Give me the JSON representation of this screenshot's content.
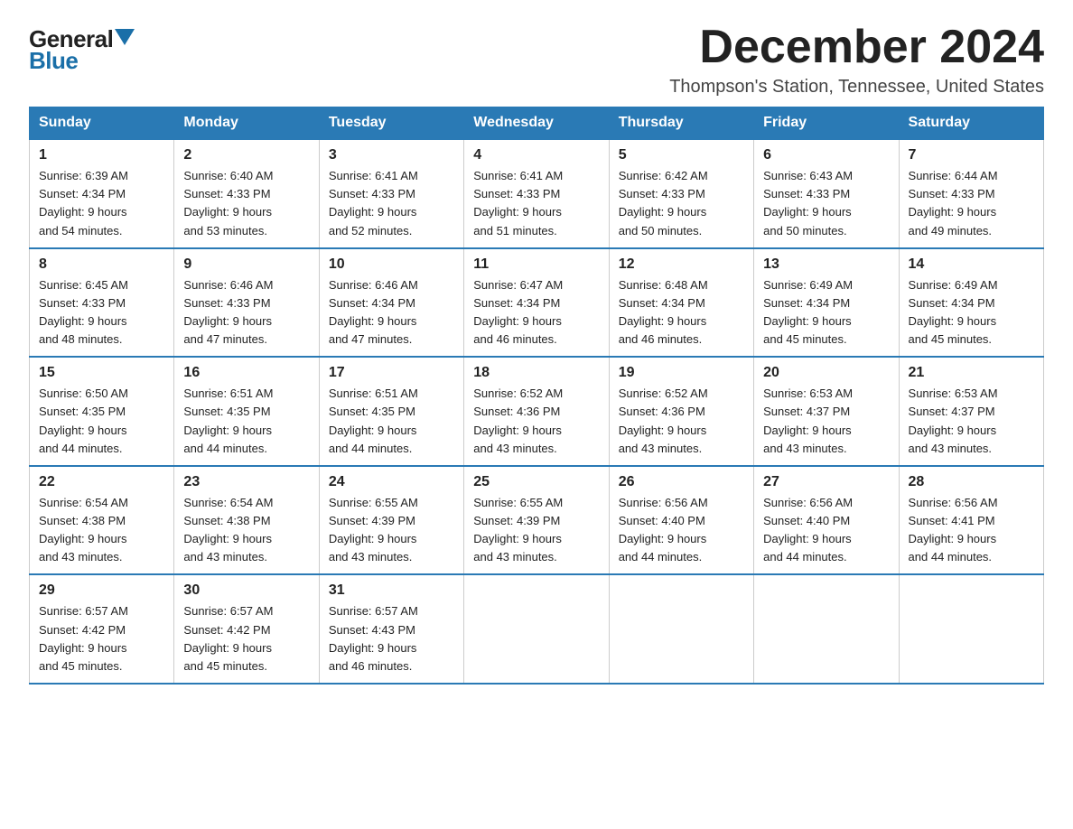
{
  "header": {
    "logo_general": "General",
    "logo_blue": "Blue",
    "month_year": "December 2024",
    "location": "Thompson's Station, Tennessee, United States"
  },
  "weekdays": [
    "Sunday",
    "Monday",
    "Tuesday",
    "Wednesday",
    "Thursday",
    "Friday",
    "Saturday"
  ],
  "weeks": [
    [
      {
        "day": "1",
        "sunrise": "6:39 AM",
        "sunset": "4:34 PM",
        "daylight": "9 hours and 54 minutes."
      },
      {
        "day": "2",
        "sunrise": "6:40 AM",
        "sunset": "4:33 PM",
        "daylight": "9 hours and 53 minutes."
      },
      {
        "day": "3",
        "sunrise": "6:41 AM",
        "sunset": "4:33 PM",
        "daylight": "9 hours and 52 minutes."
      },
      {
        "day": "4",
        "sunrise": "6:41 AM",
        "sunset": "4:33 PM",
        "daylight": "9 hours and 51 minutes."
      },
      {
        "day": "5",
        "sunrise": "6:42 AM",
        "sunset": "4:33 PM",
        "daylight": "9 hours and 50 minutes."
      },
      {
        "day": "6",
        "sunrise": "6:43 AM",
        "sunset": "4:33 PM",
        "daylight": "9 hours and 50 minutes."
      },
      {
        "day": "7",
        "sunrise": "6:44 AM",
        "sunset": "4:33 PM",
        "daylight": "9 hours and 49 minutes."
      }
    ],
    [
      {
        "day": "8",
        "sunrise": "6:45 AM",
        "sunset": "4:33 PM",
        "daylight": "9 hours and 48 minutes."
      },
      {
        "day": "9",
        "sunrise": "6:46 AM",
        "sunset": "4:33 PM",
        "daylight": "9 hours and 47 minutes."
      },
      {
        "day": "10",
        "sunrise": "6:46 AM",
        "sunset": "4:34 PM",
        "daylight": "9 hours and 47 minutes."
      },
      {
        "day": "11",
        "sunrise": "6:47 AM",
        "sunset": "4:34 PM",
        "daylight": "9 hours and 46 minutes."
      },
      {
        "day": "12",
        "sunrise": "6:48 AM",
        "sunset": "4:34 PM",
        "daylight": "9 hours and 46 minutes."
      },
      {
        "day": "13",
        "sunrise": "6:49 AM",
        "sunset": "4:34 PM",
        "daylight": "9 hours and 45 minutes."
      },
      {
        "day": "14",
        "sunrise": "6:49 AM",
        "sunset": "4:34 PM",
        "daylight": "9 hours and 45 minutes."
      }
    ],
    [
      {
        "day": "15",
        "sunrise": "6:50 AM",
        "sunset": "4:35 PM",
        "daylight": "9 hours and 44 minutes."
      },
      {
        "day": "16",
        "sunrise": "6:51 AM",
        "sunset": "4:35 PM",
        "daylight": "9 hours and 44 minutes."
      },
      {
        "day": "17",
        "sunrise": "6:51 AM",
        "sunset": "4:35 PM",
        "daylight": "9 hours and 44 minutes."
      },
      {
        "day": "18",
        "sunrise": "6:52 AM",
        "sunset": "4:36 PM",
        "daylight": "9 hours and 43 minutes."
      },
      {
        "day": "19",
        "sunrise": "6:52 AM",
        "sunset": "4:36 PM",
        "daylight": "9 hours and 43 minutes."
      },
      {
        "day": "20",
        "sunrise": "6:53 AM",
        "sunset": "4:37 PM",
        "daylight": "9 hours and 43 minutes."
      },
      {
        "day": "21",
        "sunrise": "6:53 AM",
        "sunset": "4:37 PM",
        "daylight": "9 hours and 43 minutes."
      }
    ],
    [
      {
        "day": "22",
        "sunrise": "6:54 AM",
        "sunset": "4:38 PM",
        "daylight": "9 hours and 43 minutes."
      },
      {
        "day": "23",
        "sunrise": "6:54 AM",
        "sunset": "4:38 PM",
        "daylight": "9 hours and 43 minutes."
      },
      {
        "day": "24",
        "sunrise": "6:55 AM",
        "sunset": "4:39 PM",
        "daylight": "9 hours and 43 minutes."
      },
      {
        "day": "25",
        "sunrise": "6:55 AM",
        "sunset": "4:39 PM",
        "daylight": "9 hours and 43 minutes."
      },
      {
        "day": "26",
        "sunrise": "6:56 AM",
        "sunset": "4:40 PM",
        "daylight": "9 hours and 44 minutes."
      },
      {
        "day": "27",
        "sunrise": "6:56 AM",
        "sunset": "4:40 PM",
        "daylight": "9 hours and 44 minutes."
      },
      {
        "day": "28",
        "sunrise": "6:56 AM",
        "sunset": "4:41 PM",
        "daylight": "9 hours and 44 minutes."
      }
    ],
    [
      {
        "day": "29",
        "sunrise": "6:57 AM",
        "sunset": "4:42 PM",
        "daylight": "9 hours and 45 minutes."
      },
      {
        "day": "30",
        "sunrise": "6:57 AM",
        "sunset": "4:42 PM",
        "daylight": "9 hours and 45 minutes."
      },
      {
        "day": "31",
        "sunrise": "6:57 AM",
        "sunset": "4:43 PM",
        "daylight": "9 hours and 46 minutes."
      },
      null,
      null,
      null,
      null
    ]
  ],
  "labels": {
    "sunrise": "Sunrise:",
    "sunset": "Sunset:",
    "daylight": "Daylight:"
  }
}
